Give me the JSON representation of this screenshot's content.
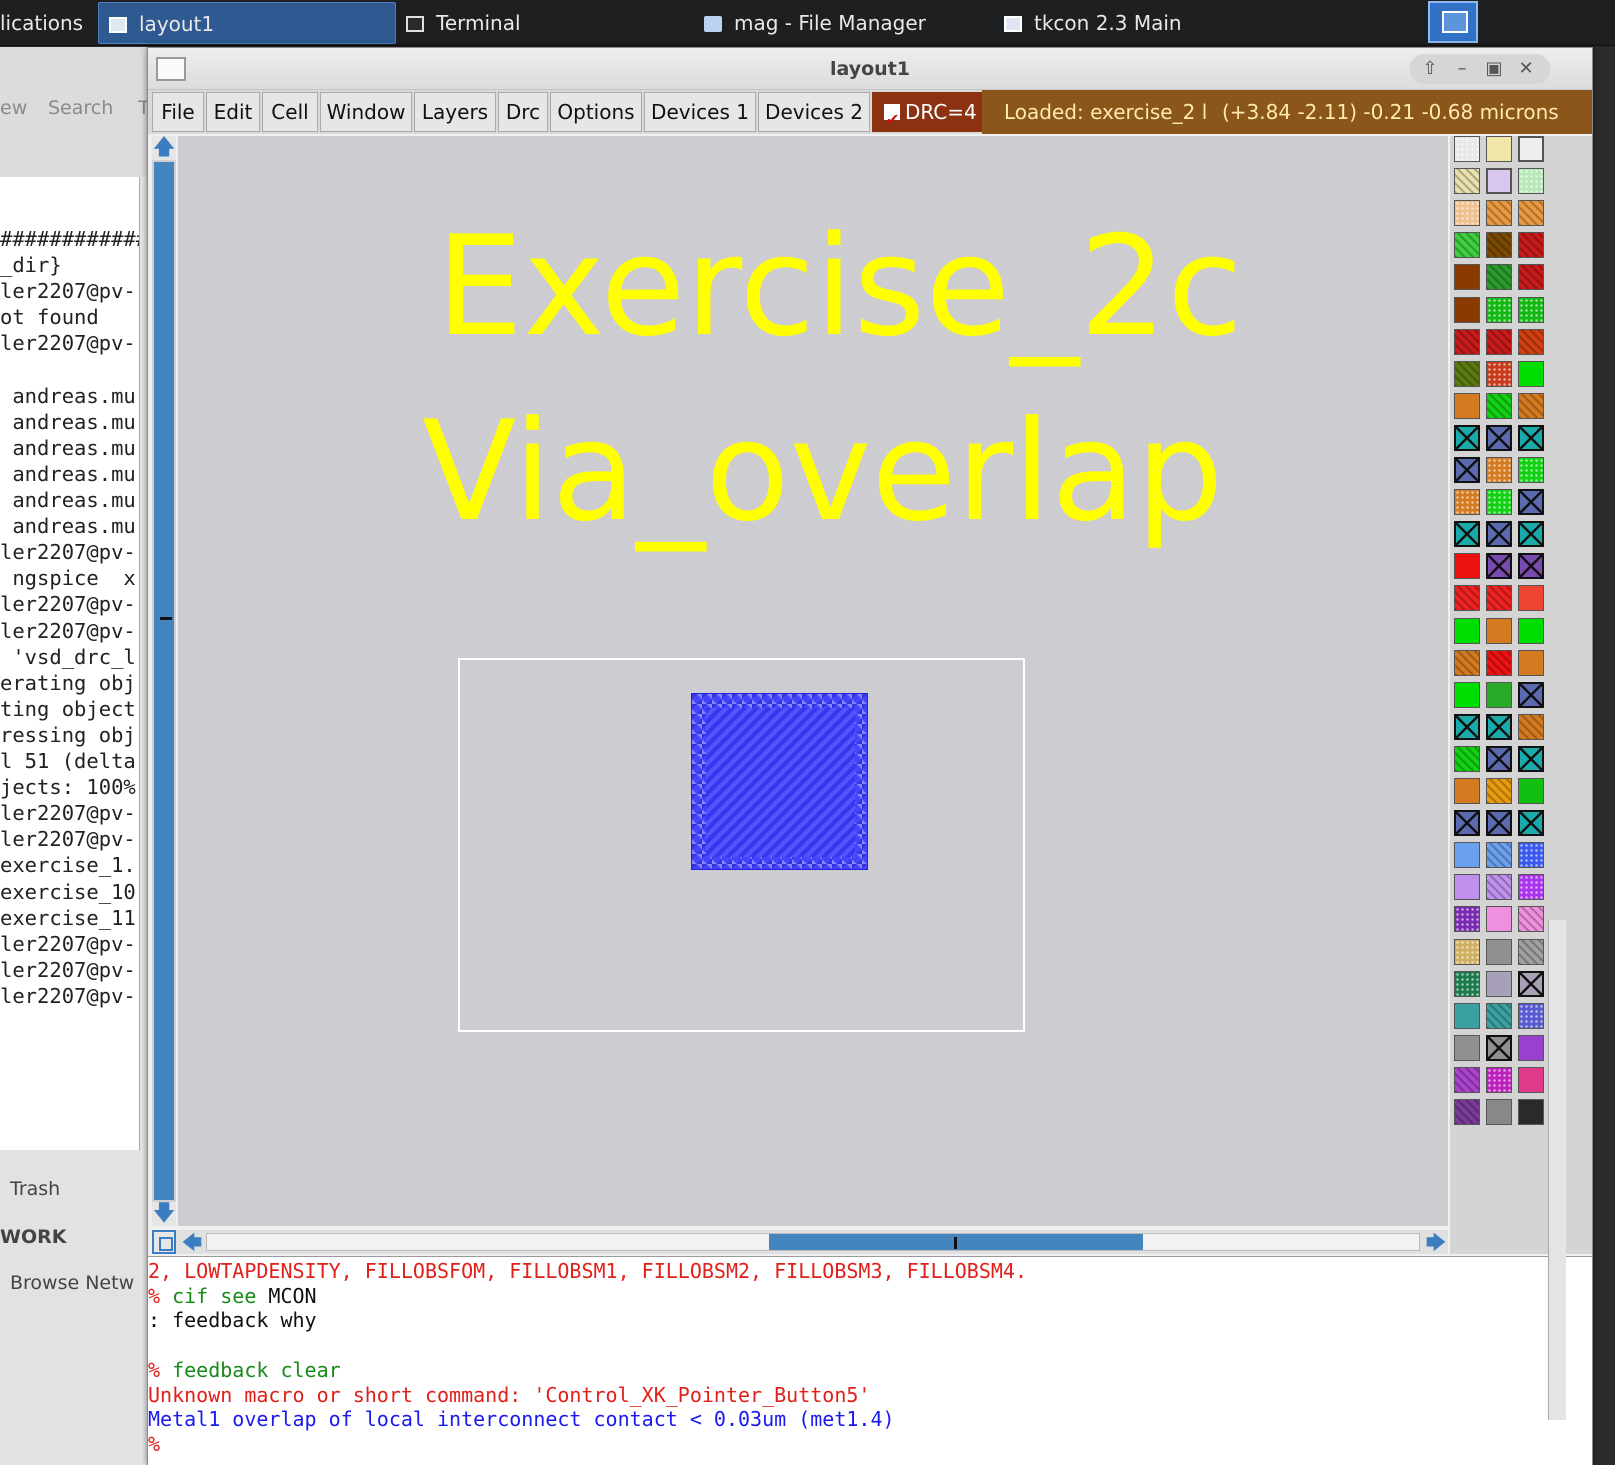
{
  "taskbar": {
    "items": [
      {
        "label": "lications"
      },
      {
        "label": "layout1"
      },
      {
        "label": "Terminal"
      },
      {
        "label": "mag - File Manager"
      },
      {
        "label": "tkcon 2.3 Main"
      }
    ]
  },
  "bg_window": {
    "toolbar": [
      "ew",
      "Search",
      "T"
    ],
    "terminal_lines": [
      "############",
      "_dir}",
      "ler2207@pv-",
      "ot found",
      "ler2207@pv-",
      "",
      " andreas.mu",
      " andreas.mu",
      " andreas.mu",
      " andreas.mu",
      " andreas.mu",
      " andreas.mu",
      "ler2207@pv-",
      " ngspice  x",
      "ler2207@pv-",
      "ler2207@pv-",
      " 'vsd_drc_l",
      "erating obj",
      "ting object",
      "ressing obj",
      "l 51 (delta",
      "jects: 100%",
      "ler2207@pv-",
      "ler2207@pv-",
      "exercise_1.",
      "exercise_10",
      "exercise_11",
      "ler2207@pv-",
      "ler2207@pv-",
      "ler2207@pv-"
    ],
    "sidebar": {
      "trash": "Trash",
      "network_header": "WORK",
      "browse_network": "Browse Netw"
    }
  },
  "magic_window": {
    "title": "layout1",
    "menus": [
      "File",
      "Edit",
      "Cell",
      "Window",
      "Layers",
      "Drc",
      "Options",
      "Devices 1",
      "Devices 2"
    ],
    "drc_label": "DRC=4",
    "status_loaded": "Loaded: exercise_2 l",
    "status_coords": "(+3.84 -2.11) -0.21 -0.68 microns",
    "canvas": {
      "label_line1": "Exercise_2c",
      "label_line2": "Via_overlap",
      "label_color": "#ffff00",
      "background_color": "#cdccd1",
      "via_color": "#4444ff"
    },
    "palette_icon": "layer-swatch-icon"
  },
  "console": {
    "lines": [
      {
        "text": "2, LOWTAPDENSITY, FILLOBSFOM, FILLOBSM1, FILLOBSM2, FILLOBSM3, FILLOBSM4.",
        "color": "red"
      },
      {
        "prompt": "% ",
        "cmd": "cif see",
        "arg": " MCON"
      },
      {
        "text": ": feedback why",
        "color": "black"
      },
      {
        "text": "",
        "color": "black"
      },
      {
        "prompt": "% ",
        "cmd": "feedback clear",
        "arg": ""
      },
      {
        "text": "Unknown macro or short command: 'Control_XK_Pointer_Button5'",
        "color": "red"
      },
      {
        "text": "Metal1 overlap of local interconnect contact < 0.03um (met1.4)",
        "color": "blue"
      },
      {
        "text": "%",
        "color": "red"
      }
    ]
  }
}
